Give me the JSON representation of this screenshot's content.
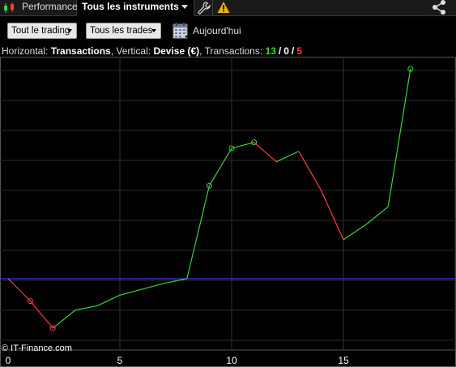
{
  "topbar": {
    "tab_performance": "Performance",
    "tab_instruments": "Tous les instruments"
  },
  "toolbar": {
    "trading_filter": "Tout le trading",
    "trades_filter": "Tous les trades",
    "date_label": "Aujourd'hui"
  },
  "info": {
    "horizontal_label": "Horizontal:",
    "horizontal_value": "Transactions",
    "vertical_label": "Vertical:",
    "vertical_value": "Devise (€)",
    "transactions_label": "Transactions:",
    "winners": "13",
    "sep1": "/",
    "neutral": "0",
    "sep2": "/",
    "losers": "5"
  },
  "watermark": "© IT-Finance.com",
  "colors": {
    "up": "#3cd23c",
    "down": "#ff3c3c",
    "baseline": "#3a4cff",
    "grid": "#2b2b2b"
  },
  "chart_data": {
    "type": "line",
    "xlabel": "",
    "ylabel": "",
    "xlim": [
      0,
      20
    ],
    "x_ticks": [
      "0",
      "5",
      "10",
      "15"
    ],
    "grid": true,
    "series": [
      {
        "x": [
          0,
          1,
          2,
          3,
          4,
          5,
          6,
          7,
          8,
          9,
          10,
          11,
          12,
          13,
          14,
          15,
          16,
          17,
          18
        ],
        "values": [
          0,
          -0.75,
          -1.65,
          -1.05,
          -0.9,
          -0.55,
          -0.35,
          -0.15,
          0,
          3.1,
          4.35,
          4.55,
          3.9,
          4.25,
          2.95,
          1.3,
          1.8,
          2.4,
          7
        ]
      }
    ],
    "markers_at": [
      1,
      2,
      9,
      10,
      11,
      18
    ],
    "baseline_value": 0
  }
}
